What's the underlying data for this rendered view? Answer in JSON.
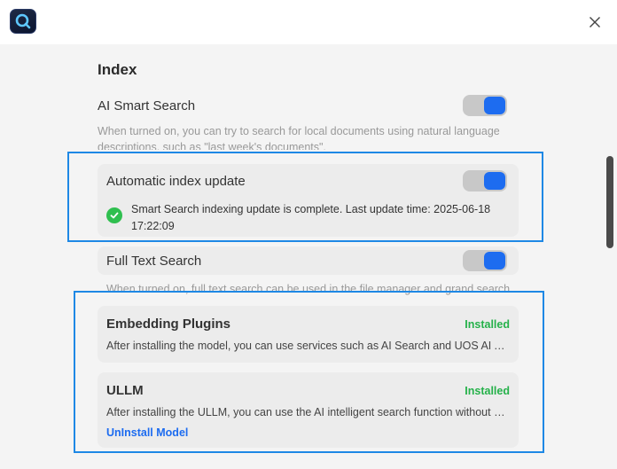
{
  "window": {
    "app_icon": "search-app-icon",
    "close_icon": "close-icon"
  },
  "index": {
    "section_title": "Index",
    "ai_smart_search": {
      "label": "AI Smart Search",
      "enabled": true,
      "description": "When turned on, you can try to search for local documents using natural language descriptions, such as \"last week's documents\"."
    },
    "automatic_index_update": {
      "label": "Automatic index update",
      "enabled": true,
      "status_text": "Smart Search indexing update is complete. Last update time: 2025-06-18 17:22:09"
    },
    "full_text_search": {
      "label": "Full Text Search",
      "enabled": true,
      "description": "When turned on, full text search can be used in the file manager and grand search."
    }
  },
  "models": {
    "embedding_plugins": {
      "title": "Embedding Plugins",
      "status": "Installed",
      "description": "After installing the model, you can use services such as AI Search and UOS AI Assistant."
    },
    "ullm": {
      "title": "ULLM",
      "status": "Installed",
      "description": "After installing the ULLM, you can use the AI intelligent search function without network.",
      "action_label": "UnInstall Model"
    }
  },
  "colors": {
    "accent": "#1d6cf0",
    "installed": "#25b14a",
    "highlight": "#1e88e5"
  }
}
